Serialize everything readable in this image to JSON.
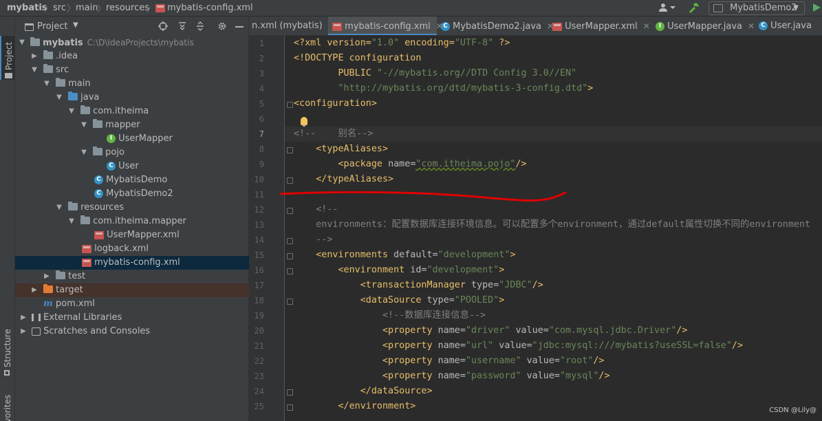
{
  "breadcrumb": {
    "items": [
      "mybatis",
      "src",
      "main",
      "resources",
      "mybatis-config.xml"
    ]
  },
  "toolbar": {
    "run_config": "MybatisDemo2"
  },
  "left_strip": {
    "project": "Project",
    "structure": "Structure",
    "favorites": "Favorites"
  },
  "project_panel": {
    "title": "Project",
    "tree": [
      {
        "label": "mybatis",
        "hint": "C:\\D\\IdeaProjects\\mybatis",
        "icon": "module-folder-icon"
      },
      {
        "label": ".idea",
        "icon": "folder-icon"
      },
      {
        "label": "src",
        "icon": "folder-icon"
      },
      {
        "label": "main",
        "icon": "folder-icon"
      },
      {
        "label": "java",
        "icon": "source-folder-icon"
      },
      {
        "label": "com.itheima",
        "icon": "package-icon"
      },
      {
        "label": "mapper",
        "icon": "package-icon"
      },
      {
        "label": "UserMapper",
        "icon": "interface-icon"
      },
      {
        "label": "pojo",
        "icon": "package-icon"
      },
      {
        "label": "User",
        "icon": "class-icon"
      },
      {
        "label": "MybatisDemo",
        "icon": "class-icon"
      },
      {
        "label": "MybatisDemo2",
        "icon": "class-icon"
      },
      {
        "label": "resources",
        "icon": "resources-folder-icon"
      },
      {
        "label": "com.itheima.mapper",
        "icon": "folder-icon"
      },
      {
        "label": "UserMapper.xml",
        "icon": "xml-file-icon"
      },
      {
        "label": "logback.xml",
        "icon": "xml-file-icon"
      },
      {
        "label": "mybatis-config.xml",
        "icon": "xml-file-icon"
      },
      {
        "label": "test",
        "icon": "folder-icon"
      },
      {
        "label": "target",
        "icon": "excluded-folder-icon"
      },
      {
        "label": "pom.xml",
        "icon": "maven-icon"
      },
      {
        "label": "External Libraries",
        "icon": "library-icon"
      },
      {
        "label": "Scratches and Consoles",
        "icon": "scratches-icon"
      }
    ]
  },
  "tabs": [
    {
      "label": "n.xml (mybatis)"
    },
    {
      "label": "mybatis-config.xml"
    },
    {
      "label": "MybatisDemo2.java"
    },
    {
      "label": "UserMapper.xml"
    },
    {
      "label": "UserMapper.java"
    },
    {
      "label": "User.java"
    }
  ],
  "editor": {
    "line_numbers": [
      "1",
      "2",
      "3",
      "4",
      "5",
      "6",
      "7",
      "8",
      "9",
      "10",
      "11",
      "12",
      "13",
      "14",
      "15",
      "16",
      "17",
      "18",
      "19",
      "20",
      "21",
      "22",
      "23",
      "24",
      "25"
    ],
    "lines": {
      "l1": [
        "<?xml version=",
        "\"1.0\"",
        " encoding=",
        "\"UTF-8\"",
        " ?>"
      ],
      "l2": [
        "<!DOCTYPE configuration"
      ],
      "l3": [
        "        PUBLIC ",
        "\"-//mybatis.org//DTD Config 3.0//EN\""
      ],
      "l4": [
        "        ",
        "\"http://mybatis.org/dtd/mybatis-3-config.dtd\"",
        ">"
      ],
      "l5": [
        "<configuration>"
      ],
      "l7": [
        "<!--    别名-->"
      ],
      "l8": [
        "    <typeAliases>"
      ],
      "l9": [
        "        <package ",
        "name",
        "=",
        "\"com.itheima.pojo\"",
        "/>"
      ],
      "l10": [
        "    </typeAliases>"
      ],
      "l12": [
        "    <!--"
      ],
      "l13": [
        "    environments：配置数据库连接环境信息。可以配置多个environment，通过default属性切换不同的environment"
      ],
      "l14": [
        "    -->"
      ],
      "l15": [
        "    <environments ",
        "default",
        "=",
        "\"development\"",
        ">"
      ],
      "l16": [
        "        <environment ",
        "id",
        "=",
        "\"development\"",
        ">"
      ],
      "l17": [
        "            <transactionManager ",
        "type",
        "=",
        "\"JDBC\"",
        "/>"
      ],
      "l18": [
        "            <dataSource ",
        "type",
        "=",
        "\"POOLED\"",
        ">"
      ],
      "l19": [
        "                <!--数据库连接信息-->"
      ],
      "l20": [
        "                <property ",
        "name",
        "=",
        "\"driver\"",
        " value",
        "=",
        "\"com.mysql.jdbc.Driver\"",
        "/>"
      ],
      "l21": [
        "                <property ",
        "name",
        "=",
        "\"url\"",
        " value",
        "=",
        "\"jdbc:mysql:///mybatis?useSSL=false\"",
        "/>"
      ],
      "l22": [
        "                <property ",
        "name",
        "=",
        "\"username\"",
        " value",
        "=",
        "\"root\"",
        "/>"
      ],
      "l23": [
        "                <property ",
        "name",
        "=",
        "\"password\"",
        " value",
        "=",
        "\"mysql\"",
        "/>"
      ],
      "l24": [
        "            </dataSource>"
      ],
      "l25": [
        "        </environment>"
      ]
    }
  },
  "watermark": "CSDN @Lily@",
  "colors": {
    "tag": "#e8bf6a",
    "attr_value": "#6a8759",
    "comment": "#808080",
    "annotation": "#e00000"
  }
}
